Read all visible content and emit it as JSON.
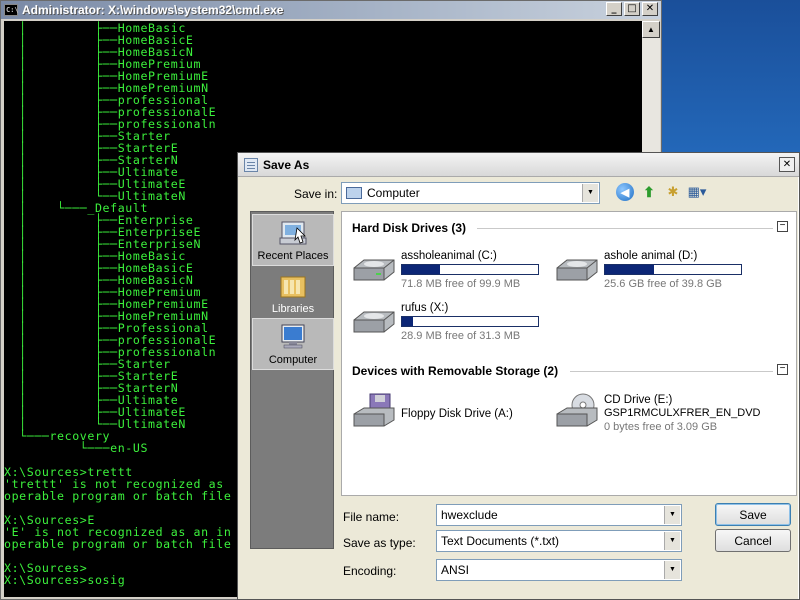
{
  "cmd": {
    "title": "Administrator: X:\\windows\\system32\\cmd.exe",
    "icon_text": "C:\\",
    "buttons": [
      "_",
      "□",
      "✕"
    ],
    "lines": [
      "  │         ├──HomeBasic",
      "  │         ├──HomeBasicE",
      "  │         ├──HomeBasicN",
      "  │         ├──HomePremium",
      "  │         ├──HomePremiumE",
      "  │         ├──HomePremiumN",
      "  │         ├──professional",
      "  │         ├──professionalE",
      "  │         ├──professionaln",
      "  │         ├──Starter",
      "  │         ├──StarterE",
      "  │         ├──StarterN",
      "  │         ├──Ultimate",
      "  │         ├──UltimateE",
      "  │         └──UltimateN",
      "  │    └───_Default",
      "  │         ├──Enterprise",
      "  │         ├──EnterpriseE",
      "  │         ├──EnterpriseN",
      "  │         ├──HomeBasic",
      "  │         ├──HomeBasicE",
      "  │         ├──HomeBasicN",
      "  │         ├──HomePremium",
      "  │         ├──HomePremiumE",
      "  │         ├──HomePremiumN",
      "  │         ├──Professional",
      "  │         ├──professionalE",
      "  │         ├──professionaln",
      "  │         ├──Starter",
      "  │         ├──StarterE",
      "  │         ├──StarterN",
      "  │         ├──Ultimate",
      "  │         ├──UltimateE",
      "  │         └──UltimateN",
      "  └───recovery",
      "          └───en-US",
      "",
      "X:\\Sources>trettt",
      "'trettt' is not recognized as",
      "operable program or batch file",
      "",
      "X:\\Sources>E",
      "'E' is not recognized as an in",
      "operable program or batch file",
      "",
      "X:\\Sources>",
      "X:\\Sources>sosig"
    ]
  },
  "dialog": {
    "title": "Save As",
    "close_label": "✕",
    "save_in_label": "Save in:",
    "save_in_value": "Computer",
    "places": [
      {
        "label": "Recent Places"
      },
      {
        "label": "Libraries"
      },
      {
        "label": "Computer"
      }
    ],
    "groups": {
      "hard_disks": {
        "title": "Hard Disk Drives (3)",
        "drives": [
          {
            "name": "assholeanimal (C:)",
            "free": "71.8 MB free of 99.9 MB",
            "used_fraction": 0.28
          },
          {
            "name": "ashole animal (D:)",
            "free": "25.6 GB free of 39.8 GB",
            "used_fraction": 0.36
          },
          {
            "name": "rufus (X:)",
            "free": "28.9 MB free of 31.3 MB",
            "used_fraction": 0.08
          }
        ]
      },
      "removable": {
        "title": "Devices with Removable Storage (2)",
        "devices": [
          {
            "name": "Floppy Disk Drive (A:)"
          },
          {
            "name": "CD Drive (E:)",
            "label": "GSP1RMCULXFRER_EN_DVD",
            "free": "0 bytes free of 3.09 GB"
          }
        ]
      }
    },
    "file_name_label": "File name:",
    "file_name_value": "hwexclude",
    "save_type_label": "Save as type:",
    "save_type_value": "Text Documents (*.txt)",
    "encoding_label": "Encoding:",
    "encoding_value": "ANSI",
    "save_button": "Save",
    "cancel_button": "Cancel"
  },
  "colors": {
    "cmd_text": "#3cf03c",
    "cmd_bg": "#000000",
    "drive_bar": "#0c2676"
  }
}
